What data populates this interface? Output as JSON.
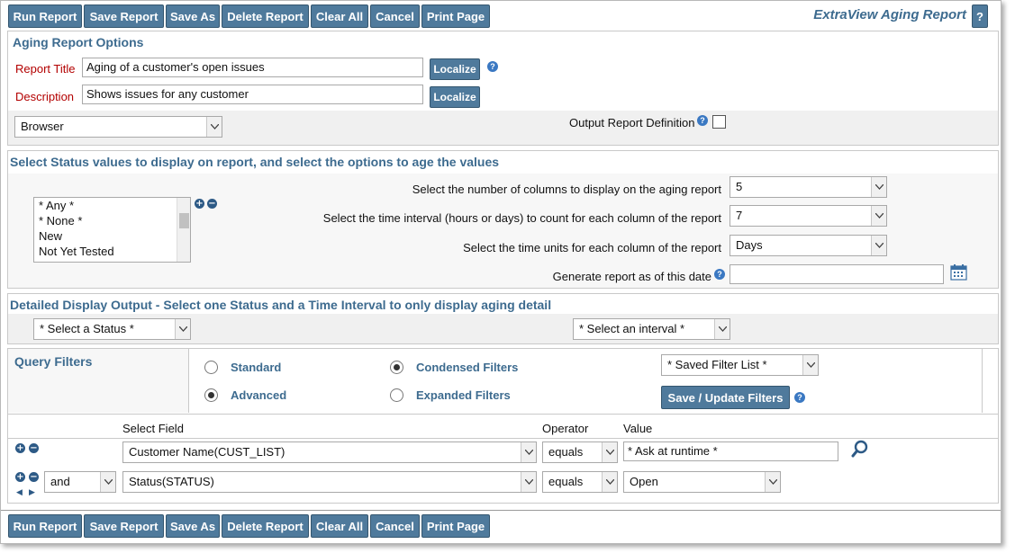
{
  "toolbar": {
    "buttons": [
      "Run Report",
      "Save Report",
      "Save As",
      "Delete Report",
      "Clear All",
      "Cancel",
      "Print Page"
    ],
    "title": "ExtraView Aging Report",
    "help": "?"
  },
  "options": {
    "title": "Aging Report Options",
    "report_title_label": "Report Title",
    "report_title_value": "Aging of a customer's open issues",
    "description_label": "Description",
    "description_value": "Shows issues for any customer",
    "localize": "Localize",
    "output_select": "Browser",
    "output_def_label": "Output Report Definition"
  },
  "status": {
    "title": "Select Status values to display on report, and select the options to age the values",
    "list": [
      "* Any *",
      "* None *",
      "New",
      "Not Yet Tested"
    ],
    "columns_label": "Select the number of columns to display on the aging report",
    "columns_value": "5",
    "interval_label": "Select the time interval (hours or days) to count for each column of the report",
    "interval_value": "7",
    "units_label": "Select the time units for each column of the report",
    "units_value": "Days",
    "date_label": "Generate report as of this date",
    "date_value": ""
  },
  "detail": {
    "title": "Detailed Display Output - Select one Status and a Time Interval to only display aging detail",
    "status_select": "* Select a Status *",
    "interval_select": "* Select an interval *"
  },
  "filters": {
    "title": "Query Filters",
    "standard": "Standard",
    "advanced": "Advanced",
    "condensed": "Condensed Filters",
    "expanded": "Expanded Filters",
    "saved_list": "* Saved Filter List *",
    "save_update": "Save / Update Filters",
    "col_field": "Select Field",
    "col_operator": "Operator",
    "col_value": "Value",
    "rows": [
      {
        "conj": "",
        "field": "Customer Name(CUST_LIST)",
        "operator": "equals",
        "value": "* Ask at runtime *"
      },
      {
        "conj": "and",
        "field": "Status(STATUS)",
        "operator": "equals",
        "value": "Open"
      }
    ]
  },
  "colors": {
    "button": "#4f7a9c",
    "heading": "#3d6b8f",
    "required_label": "#b30000"
  }
}
